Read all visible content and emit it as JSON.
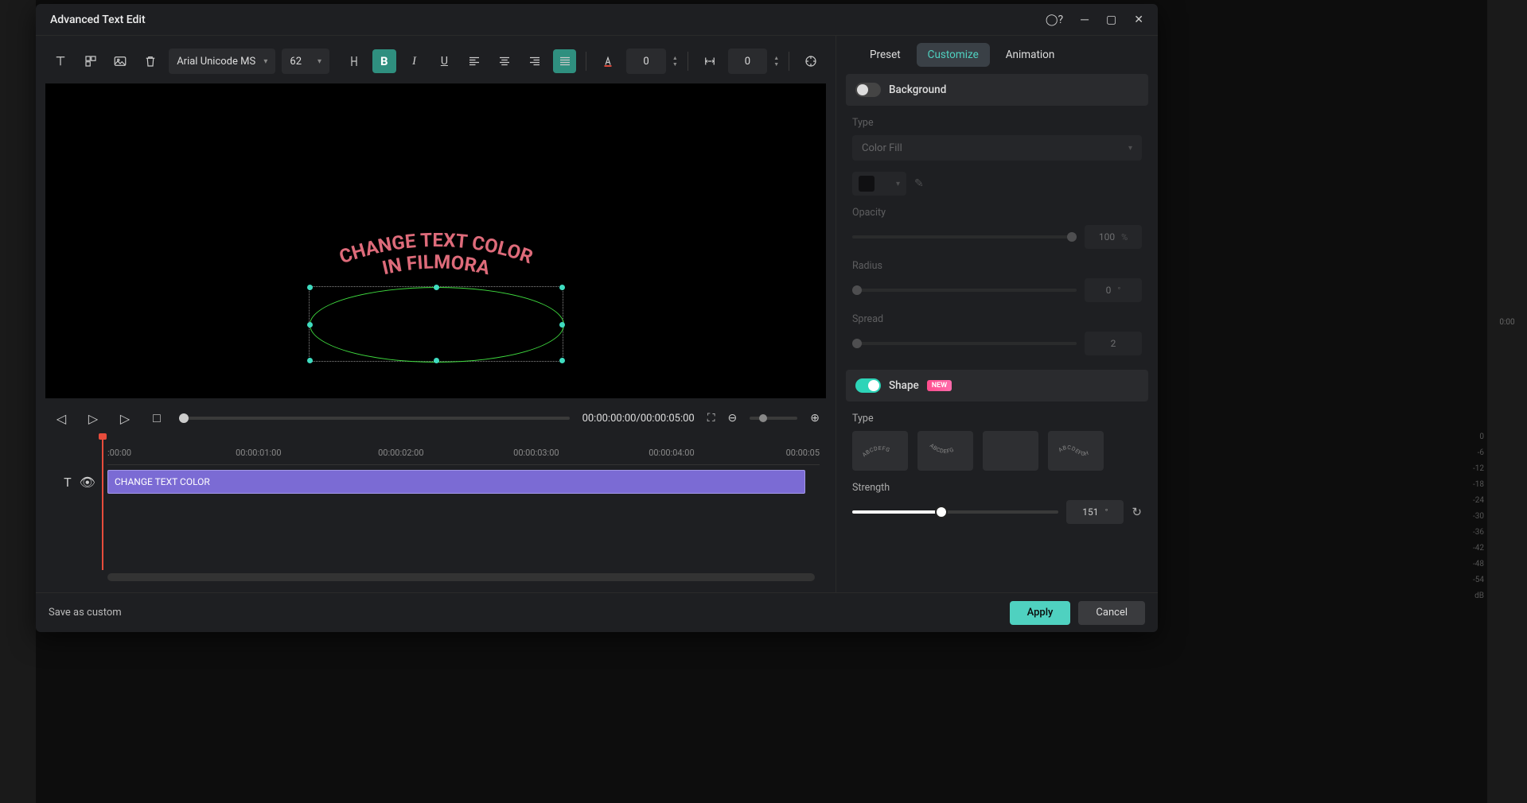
{
  "dialog": {
    "title": "Advanced Text Edit"
  },
  "toolbar": {
    "font": "Arial Unicode MS",
    "size": "62",
    "value1": "0",
    "value2": "0"
  },
  "preview": {
    "text_line1": "CHANGE TEXT COLOR",
    "text_line2": "IN FILMORA"
  },
  "playback": {
    "timecode": "00:00:00:00/00:00:05:00"
  },
  "timeline": {
    "marks": [
      ":00:00",
      "00:00:01:00",
      "00:00:02:00",
      "00:00:03:00",
      "00:00:04:00",
      "00:00:05"
    ],
    "clip_label": "CHANGE TEXT COLOR"
  },
  "tabs": {
    "preset": "Preset",
    "customize": "Customize",
    "animation": "Animation"
  },
  "props": {
    "background": {
      "label": "Background",
      "type_label": "Type",
      "type_value": "Color Fill",
      "opacity_label": "Opacity",
      "opacity_value": "100",
      "opacity_unit": "%",
      "radius_label": "Radius",
      "radius_value": "0",
      "radius_unit": "°",
      "spread_label": "Spread",
      "spread_value": "2"
    },
    "shape": {
      "label": "Shape",
      "new_badge": "NEW",
      "type_label": "Type",
      "strength_label": "Strength",
      "strength_value": "151",
      "strength_unit": "°"
    }
  },
  "footer": {
    "save": "Save as custom",
    "apply": "Apply",
    "cancel": "Cancel"
  },
  "meters": [
    "0",
    "-6",
    "-12",
    "-18",
    "-24",
    "-30",
    "-36",
    "-42",
    "-48",
    "-54",
    "dB"
  ],
  "bg_time": "0:00"
}
